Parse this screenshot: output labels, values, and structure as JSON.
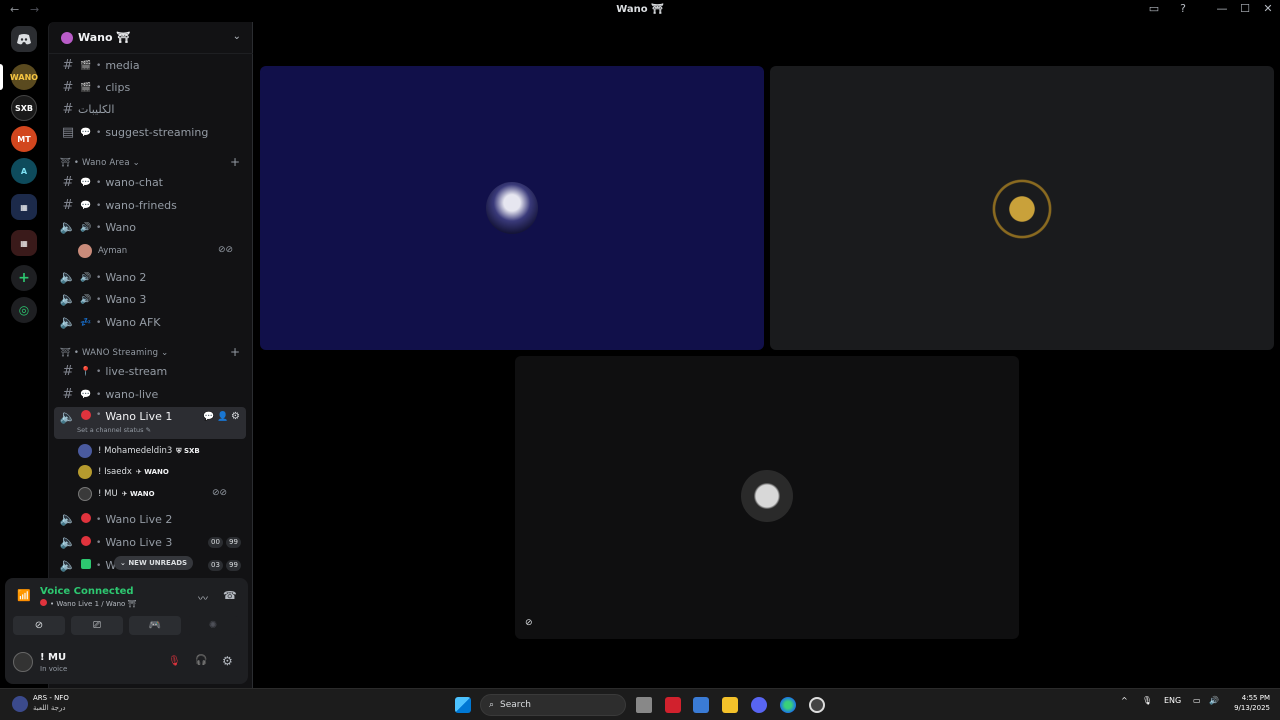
{
  "window": {
    "title": "Wano ⛩",
    "back": "←",
    "forward": "→",
    "controls": [
      "—",
      "☐",
      "✕"
    ]
  },
  "guild": {
    "name": "Wano ⛩"
  },
  "channels_top": [
    {
      "name": "media",
      "emoji": "🎬"
    },
    {
      "name": "clips",
      "emoji": "🎬"
    },
    {
      "name": "الكليبات",
      "emoji": ""
    },
    {
      "name": "suggest-streaming",
      "emoji": "💬"
    }
  ],
  "category_area": {
    "name": "Wano Area"
  },
  "channels_area": [
    {
      "name": "wano-chat",
      "emoji": "💬",
      "type": "text"
    },
    {
      "name": "wano-frineds",
      "emoji": "💬",
      "type": "text"
    },
    {
      "name": "Wano",
      "emoji": "🔊",
      "type": "voice"
    },
    {
      "name": "Wano 2",
      "emoji": "🔊",
      "type": "voice"
    },
    {
      "name": "Wano 3",
      "emoji": "🔊",
      "type": "voice"
    },
    {
      "name": "Wano AFK",
      "emoji": "💤",
      "type": "voice"
    }
  ],
  "wano_members": [
    {
      "name": "Ayman"
    }
  ],
  "category_streaming": {
    "name": "WANO Streaming"
  },
  "channels_streaming": [
    {
      "name": "live-stream",
      "emoji": "📍"
    },
    {
      "name": "wano-live",
      "emoji": "💬"
    }
  ],
  "active_channel": {
    "name": "Wano Live 1",
    "status": "Set a channel status ✎"
  },
  "live_members": [
    {
      "name": "! Mohamedeldin3",
      "tag": "SXB"
    },
    {
      "name": "! Isaedx",
      "tag": "WANO"
    },
    {
      "name": "! MU",
      "tag": "WANO"
    }
  ],
  "channels_live": [
    {
      "name": "Wano Live 2",
      "badges": []
    },
    {
      "name": "Wano Live 3",
      "badges": [
        "00",
        "99"
      ]
    },
    {
      "name": "Wa",
      "badges": [
        "03",
        "99"
      ]
    }
  ],
  "new_unreads": "NEW UNREADS",
  "voice": {
    "title": "Voice Connected",
    "subtitle": "Wano Live 1 / Wano ⛩"
  },
  "user": {
    "name": "! MU",
    "status": "In voice"
  },
  "colors": {
    "accent_green": "#2dc770",
    "tile_blue": "#11104a",
    "tile_dark": "#1a1b1d",
    "tile_black": "#0f0f10",
    "red": "#e0333d"
  },
  "taskbar": {
    "weather_line1": "ARS - NFO",
    "weather_line2": "درجة اللعبة",
    "search": "Search",
    "lang": "ENG",
    "time": "4:55 PM",
    "date": "9/13/2025"
  }
}
